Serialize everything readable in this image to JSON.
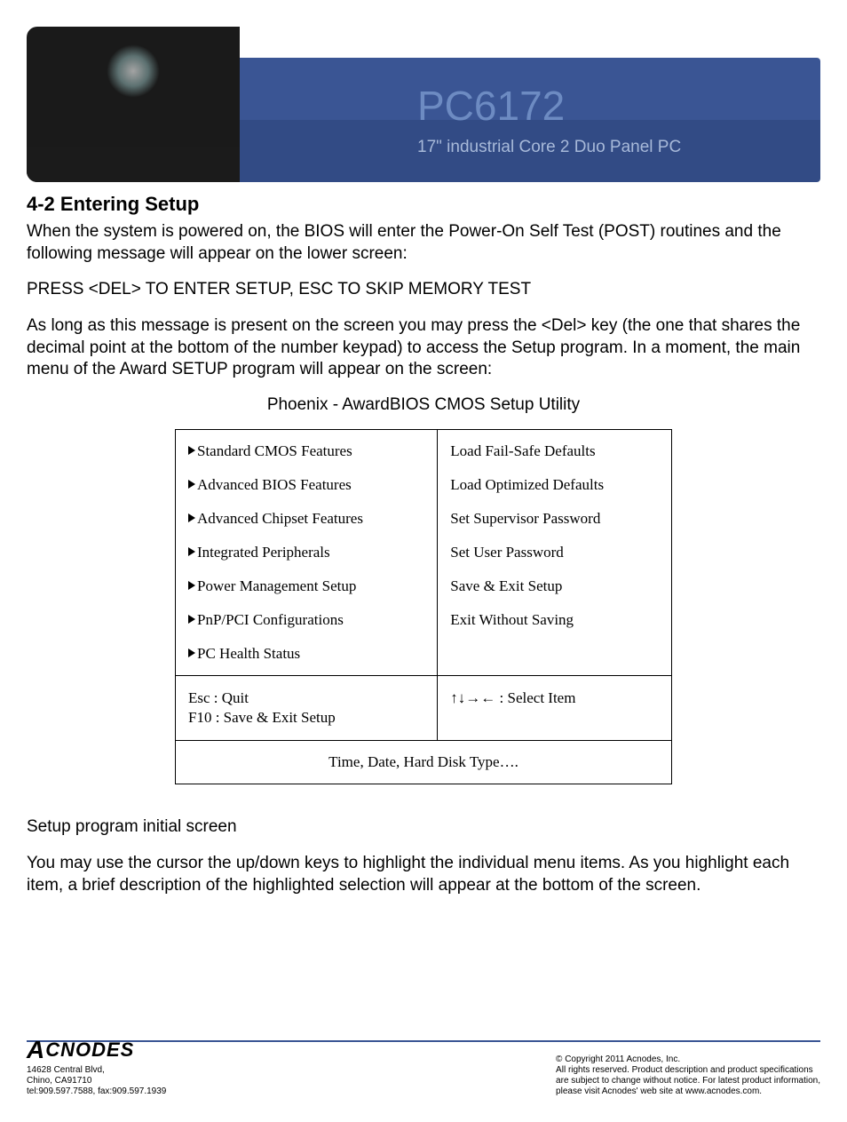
{
  "banner": {
    "title": "PC6172",
    "subtitle": "17\" industrial Core 2 Duo Panel PC"
  },
  "section_heading": "4-2  Entering Setup",
  "para1": "When the system is powered on, the BIOS will enter the Power-On Self Test (POST) routines and the following message will appear on the lower screen:",
  "para2": "PRESS <DEL> TO ENTER SETUP, ESC TO SKIP MEMORY TEST",
  "para3": "As long as this message is present on the screen you may press the <Del> key (the one that shares the decimal point at the bottom of the number keypad) to access the Setup program. In a moment, the main menu of the Award SETUP program will appear on the screen:",
  "bios_title": "Phoenix - AwardBIOS CMOS Setup Utility",
  "bios_menu": {
    "left": [
      "Standard CMOS Features",
      "Advanced BIOS Features",
      "Advanced Chipset Features",
      "Integrated Peripherals",
      "Power Management Setup",
      "PnP/PCI Configurations",
      "PC Health Status"
    ],
    "right": [
      "Load Fail-Safe Defaults",
      "Load Optimized Defaults",
      "Set Supervisor Password",
      "Set User Password",
      "Save & Exit Setup",
      "Exit Without Saving"
    ],
    "nav_left": "Esc : Quit\nF10 : Save & Exit Setup",
    "nav_right": "↑↓→← : Select Item",
    "hint": "Time, Date, Hard Disk Type…."
  },
  "para4": "Setup program initial screen",
  "para5": "You may use the cursor the up/down keys to highlight the individual menu items.  As  you  highlight each item,  a  brief  description  of  the  highlighted  selection will appear at the bottom of the screen.",
  "footer": {
    "logo": "CNODES",
    "addr1": "14628 Central Blvd,",
    "addr2": "Chino, CA91710",
    "addr3": "tel:909.597.7588, fax:909.597.1939",
    "copy1": "© Copyright 2011 Acnodes, Inc.",
    "copy2": "All rights reserved. Product description and product specifications",
    "copy3": "are subject to change without notice. For latest product information,",
    "copy4": "please visit Acnodes' web site at www.acnodes.com."
  }
}
